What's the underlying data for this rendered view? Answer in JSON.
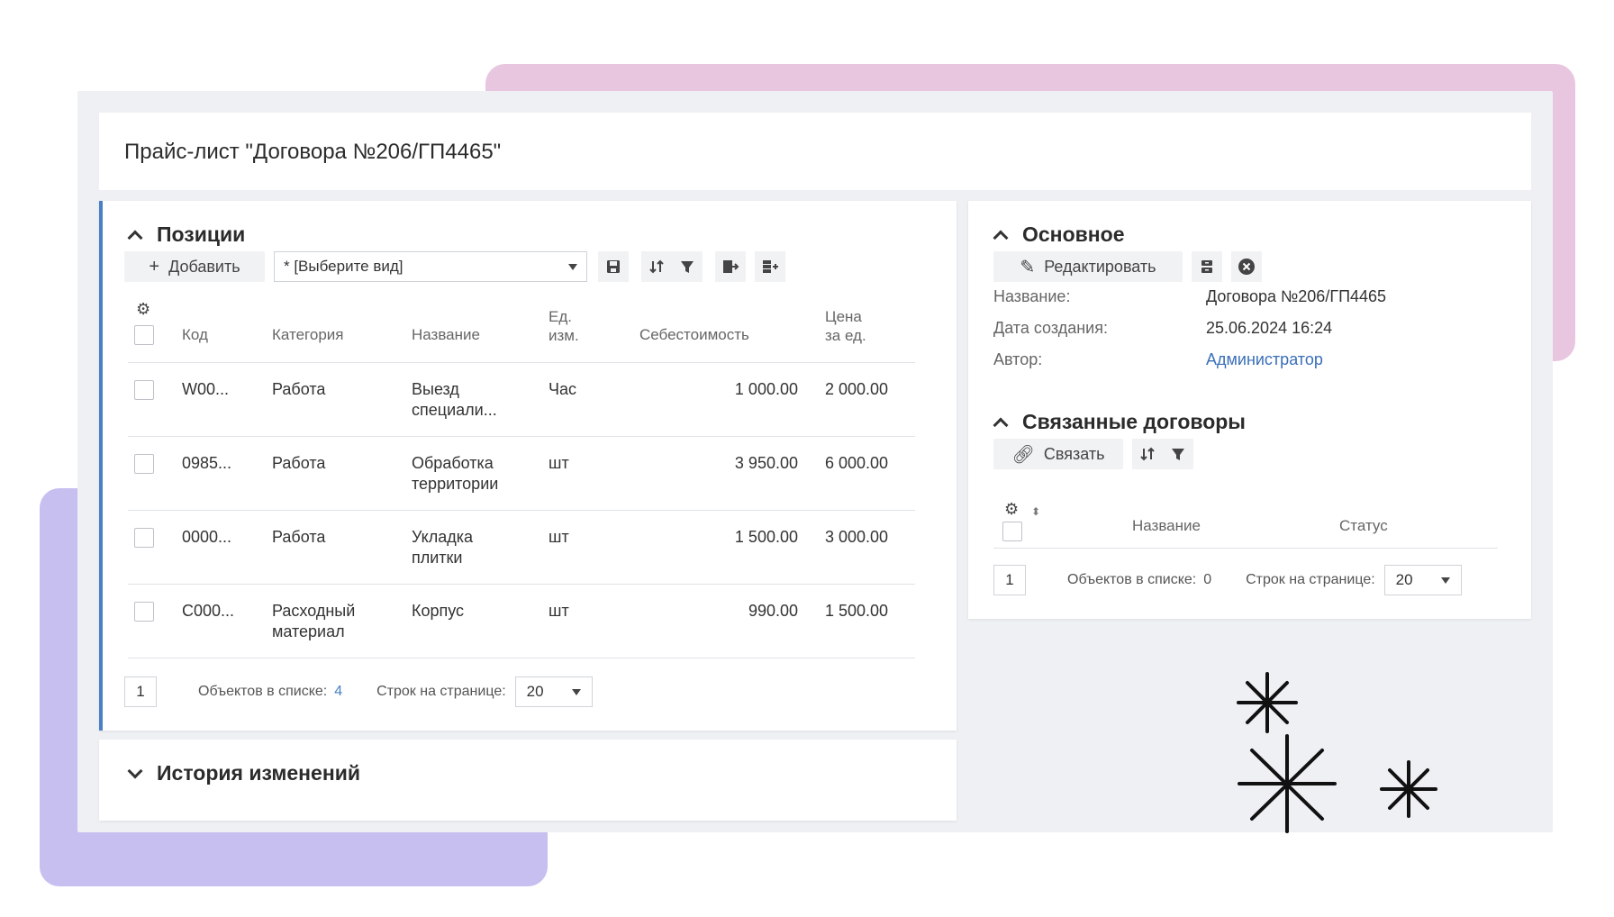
{
  "page_title": "Прайс-лист \"Договора №206/ГП4465\"",
  "positions": {
    "title": "Позиции",
    "add_label": "Добавить",
    "view_select": "* [Выберите вид]",
    "columns": {
      "code": "Код",
      "category": "Категория",
      "name": "Название",
      "unit_l1": "Ед.",
      "unit_l2": "изм.",
      "cost": "Себестоимость",
      "price_l1": "Цена",
      "price_l2": "за ед."
    },
    "rows": [
      {
        "code": "W00...",
        "category_l1": "Работа",
        "category_l2": "",
        "name_l1": "Выезд",
        "name_l2": "специали...",
        "unit": "Час",
        "cost": "1 000.00",
        "price": "2 000.00"
      },
      {
        "code": "0985...",
        "category_l1": "Работа",
        "category_l2": "",
        "name_l1": "Обработка",
        "name_l2": "территории",
        "unit": "шт",
        "cost": "3 950.00",
        "price": "6 000.00"
      },
      {
        "code": "0000...",
        "category_l1": "Работа",
        "category_l2": "",
        "name_l1": "Укладка",
        "name_l2": "плитки",
        "unit": "шт",
        "cost": "1 500.00",
        "price": "3 000.00"
      },
      {
        "code": "C000...",
        "category_l1": "Расходный",
        "category_l2": "материал",
        "name_l1": "Корпус",
        "name_l2": "",
        "unit": "шт",
        "cost": "990.00",
        "price": "1 500.00"
      }
    ],
    "pager": {
      "page": "1",
      "count_label": "Объектов в списке:",
      "count": "4",
      "rows_label": "Строк на странице:",
      "rows_value": "20"
    }
  },
  "history": {
    "title": "История изменений"
  },
  "main": {
    "title": "Основное",
    "edit_label": "Редактировать",
    "fields": [
      {
        "label": "Название:",
        "value": "Договора №206/ГП4465"
      },
      {
        "label": "Дата создания:",
        "value": "25.06.2024 16:24"
      },
      {
        "label": "Автор:",
        "value": "Администратор"
      }
    ]
  },
  "related": {
    "title": "Связанные договоры",
    "link_label": "Связать",
    "columns": {
      "name": "Название",
      "status": "Статус"
    },
    "pager": {
      "page": "1",
      "count_label": "Объектов в списке:",
      "count": "0",
      "rows_label": "Строк на странице:",
      "rows_value": "20"
    }
  },
  "colors": {
    "accent": "#4a80c3",
    "deco_pink": "#e8c6df",
    "deco_purple": "#c6bff0"
  },
  "icons": [
    "chevron-up-icon",
    "plus-icon",
    "save-icon",
    "sort-icon",
    "filter-icon",
    "export-icon",
    "columns-icon",
    "gear-icon",
    "pencil-icon",
    "archive-icon",
    "close-circle-icon",
    "link-icon",
    "chevron-down-icon",
    "sparkle-icon"
  ]
}
